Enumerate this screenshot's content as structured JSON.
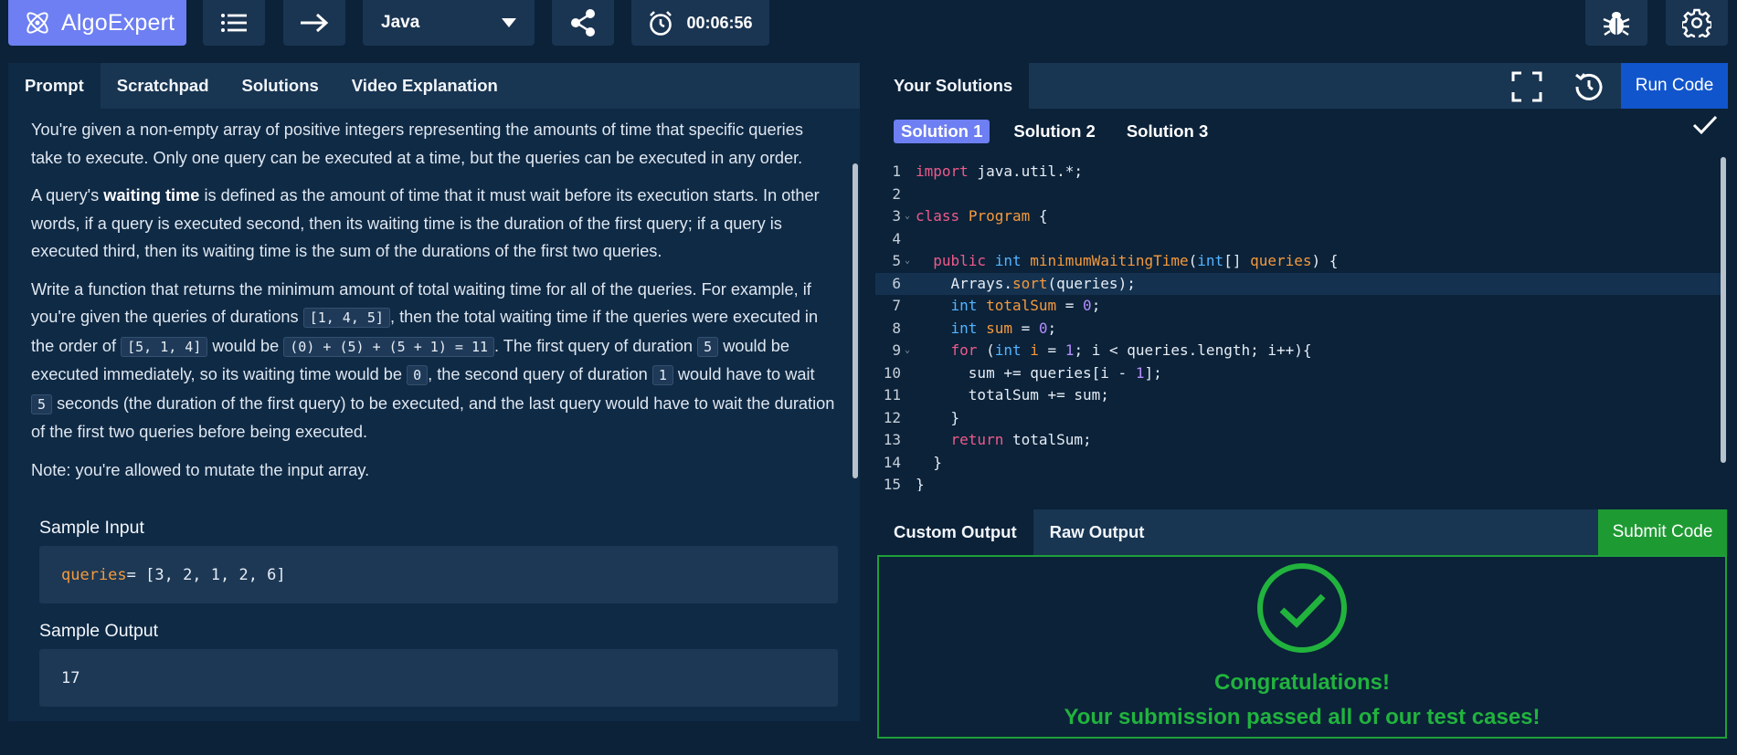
{
  "app": {
    "brand": "AlgoExpert"
  },
  "toolbar": {
    "language": "Java",
    "timer": "00:06:56"
  },
  "left_tabs": [
    "Prompt",
    "Scratchpad",
    "Solutions",
    "Video Explanation"
  ],
  "prompt": {
    "p1": "You're given a non-empty array of positive integers representing the amounts of time that specific queries take to execute. Only one query can be executed at a time, but the queries can be executed in any order.",
    "p2_a": "A query's ",
    "p2_bold": "waiting time",
    "p2_b": " is defined as the amount of time that it must wait before its execution starts. In other words, if a query is executed second, then its waiting time is the duration of the first query; if a query is executed third, then its waiting time is the sum of the durations of the first two queries.",
    "p3_a": "Write a function that returns the minimum amount of total waiting time for all of the queries. For example, if you're given the queries of durations ",
    "p3_c1": "[1, 4, 5]",
    "p3_b": ", then the total waiting time if the queries were executed in the order of ",
    "p3_c2": "[5, 1, 4]",
    "p3_c": " would be ",
    "p3_c3": "(0) + (5) + (5 + 1) = 11",
    "p3_d": ". The first query of duration ",
    "p3_c4": "5",
    "p3_e": " would be executed immediately, so its waiting time would be ",
    "p3_c5": "0",
    "p3_f": ", the second query of duration ",
    "p3_c6": "1",
    "p3_g": " would have to wait ",
    "p3_c7": "5",
    "p3_h": " seconds (the duration of the first query) to be executed, and the last query would have to wait the duration of the first two queries before being executed.",
    "p4": "Note: you're allowed to mutate the input array.",
    "sample_input_title": "Sample Input",
    "sample_input_var": "queries",
    "sample_input_rest": " = [3, 2, 1, 2, 6]",
    "sample_output_title": "Sample Output",
    "sample_output_value": "17"
  },
  "right": {
    "header_tab": "Your Solutions",
    "run_label": "Run Code",
    "solution_tabs": [
      "Solution 1",
      "Solution 2",
      "Solution 3"
    ],
    "line_numbers": [
      "1",
      "2",
      "3",
      "4",
      "5",
      "6",
      "7",
      "8",
      "9",
      "10",
      "11",
      "12",
      "13",
      "14",
      "15"
    ],
    "output_tabs": [
      "Custom Output",
      "Raw Output"
    ],
    "submit_label": "Submit Code",
    "congrats_title": "Congratulations!",
    "congrats_message": "Your submission passed all of our test cases!"
  },
  "colors": {
    "accent": "#6d7ff2",
    "run": "#1155cc",
    "success": "#21b33d",
    "bg": "#0b2239"
  },
  "icons": [
    "atom-logo-icon",
    "list-icon",
    "arrow-right-icon",
    "chevron-down-icon",
    "share-icon",
    "stopwatch-icon",
    "bug-icon",
    "gear-icon",
    "fullscreen-icon",
    "reset-icon",
    "check-icon",
    "check-circle-icon"
  ]
}
